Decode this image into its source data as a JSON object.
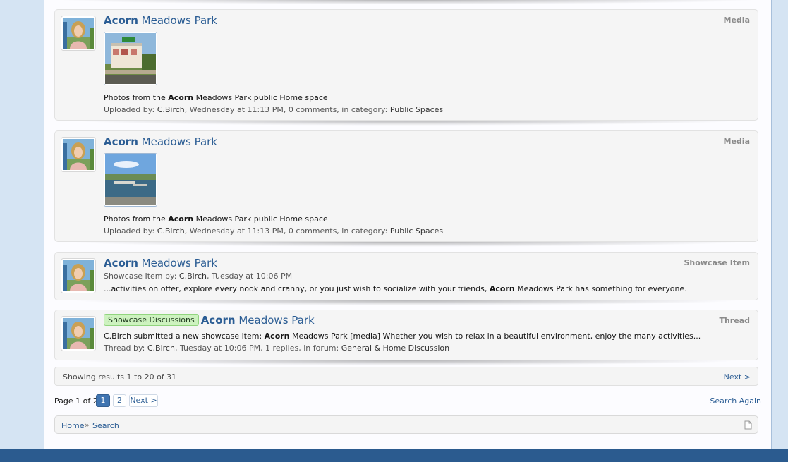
{
  "results": [
    {
      "title_keyword": "Acorn",
      "title_rest": " Meadows Park",
      "type": "Media",
      "snippet_pre": "Photos from the ",
      "snippet_kw": "Acorn",
      "snippet_post": " Meadows Park public Home space",
      "meta_prefix": "Uploaded by: ",
      "user": "C.Birch",
      "meta_mid": ", Wednesday at 11:13 PM, 0 comments, in category: ",
      "category": "Public Spaces",
      "thumb_icon": "building-photo"
    },
    {
      "title_keyword": "Acorn",
      "title_rest": " Meadows Park",
      "type": "Media",
      "snippet_pre": "Photos from the ",
      "snippet_kw": "Acorn",
      "snippet_post": " Meadows Park public Home space",
      "meta_prefix": "Uploaded by: ",
      "user": "C.Birch",
      "meta_mid": ", Wednesday at 11:13 PM, 0 comments, in category: ",
      "category": "Public Spaces",
      "thumb_icon": "pond-photo"
    },
    {
      "title_keyword": "Acorn",
      "title_rest": " Meadows Park",
      "type": "Showcase Item",
      "meta_prefix": "Showcase Item by: ",
      "user": "C.Birch",
      "meta_mid": ", Tuesday at 10:06 PM",
      "snippet_pre": "...activities on offer, explore every nook and cranny, or you just wish to socialize with your friends, ",
      "snippet_kw": "Acorn",
      "snippet_post": " Meadows Park has something for everyone."
    },
    {
      "prefix_label": "Showcase Discussions",
      "title_keyword": "Acorn",
      "title_rest": " Meadows Park",
      "type": "Thread",
      "snippet_pre": "C.Birch submitted a new showcase item: ",
      "snippet_kw": "Acorn",
      "snippet_post": " Meadows Park [media] Whether you wish to relax in a beautiful environment, enjoy the many activities...",
      "meta_prefix": "Thread by: ",
      "user": "C.Birch",
      "meta_mid": ", Tuesday at 10:06 PM, 1 replies, in forum: ",
      "category": "General & Home Discussion"
    }
  ],
  "showing": {
    "text": "Showing results 1 to 20 of 31",
    "next": "Next >"
  },
  "pager": {
    "label": "Page 1 of 2",
    "pages": [
      "1",
      "2"
    ],
    "next": "Next >"
  },
  "search_again": "Search Again",
  "breadcrumb": {
    "home": "Home",
    "separator": "»",
    "search": "Search"
  },
  "colors": {
    "link": "#2b5d94",
    "prefix_bg": "#cdf2bf",
    "current_page": "#3f74b1",
    "footer": "#2b5b8f"
  },
  "icons": {
    "avatar": "user-avatar",
    "jump": "page-icon"
  }
}
